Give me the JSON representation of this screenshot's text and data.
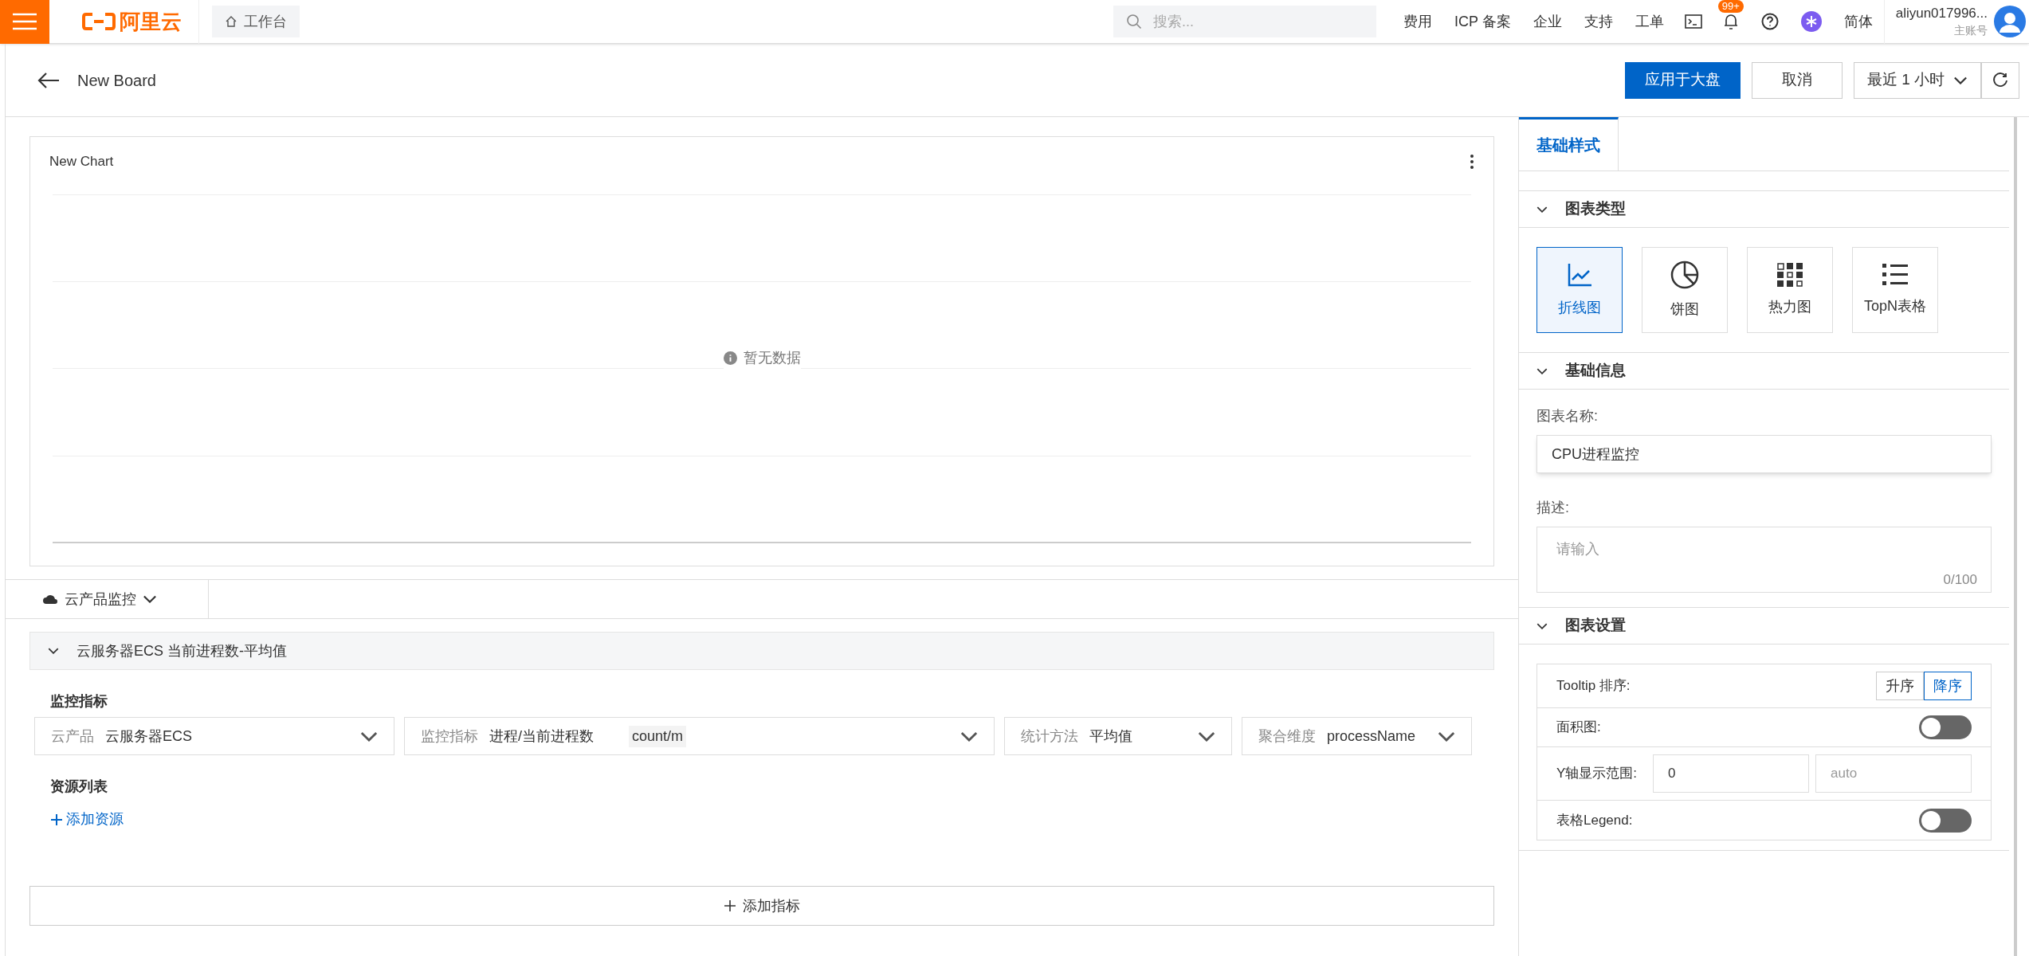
{
  "topbar": {
    "logo": "阿里云",
    "workbench": "工作台",
    "search": {
      "placeholder": "搜索..."
    },
    "nav": [
      "费用",
      "ICP 备案",
      "企业",
      "支持",
      "工单"
    ],
    "notification_badge": "99+",
    "language": "简体",
    "account": {
      "name": "aliyun017996...",
      "role": "主账号"
    }
  },
  "header": {
    "title": "New Board",
    "apply_button": "应用于大盘",
    "cancel_button": "取消",
    "time_range": "最近 1 小时"
  },
  "chart": {
    "title": "New Chart",
    "empty_text": "暂无数据"
  },
  "source_tab": {
    "label": "云产品监控"
  },
  "metric": {
    "title": "云服务器ECS 当前进程数-平均值",
    "expanded": true,
    "section_label": "监控指标",
    "selects": [
      {
        "label": "云产品",
        "value": "云服务器ECS"
      },
      {
        "label": "监控指标",
        "value": "进程/当前进程数",
        "unit": "count/m"
      },
      {
        "label": "统计方法",
        "value": "平均值"
      },
      {
        "label": "聚合维度",
        "value": "processName"
      }
    ],
    "resources_label": "资源列表",
    "add_resource": "添加资源"
  },
  "add_metric": "添加指标",
  "panel": {
    "tabs": [
      {
        "label": "基础样式",
        "selected": true
      }
    ],
    "chart_type": {
      "heading": "图表类型",
      "expanded": true,
      "types": [
        {
          "kind": "line",
          "label": "折线图",
          "selected": true
        },
        {
          "kind": "pie",
          "label": "饼图",
          "selected": false
        },
        {
          "kind": "heatmap",
          "label": "热力图",
          "selected": false
        },
        {
          "kind": "topn",
          "label": "TopN表格",
          "selected": false
        }
      ]
    },
    "basic_info": {
      "heading": "基础信息",
      "expanded": true,
      "name_label": "图表名称:",
      "name_value": "CPU进程监控",
      "desc_label": "描述:",
      "desc_placeholder": "请输入",
      "desc_count": "0/100"
    },
    "settings": {
      "heading": "图表设置",
      "expanded": true,
      "tooltip_label": "Tooltip 排序:",
      "sort_options": [
        {
          "label": "升序",
          "selected": false
        },
        {
          "label": "降序",
          "selected": true
        }
      ],
      "area_label": "面积图:",
      "area_on": false,
      "y_range_label": "Y轴显示范围:",
      "y_min": "0",
      "y_max_placeholder": "auto",
      "legend_label": "表格Legend:",
      "legend_on": false
    }
  }
}
